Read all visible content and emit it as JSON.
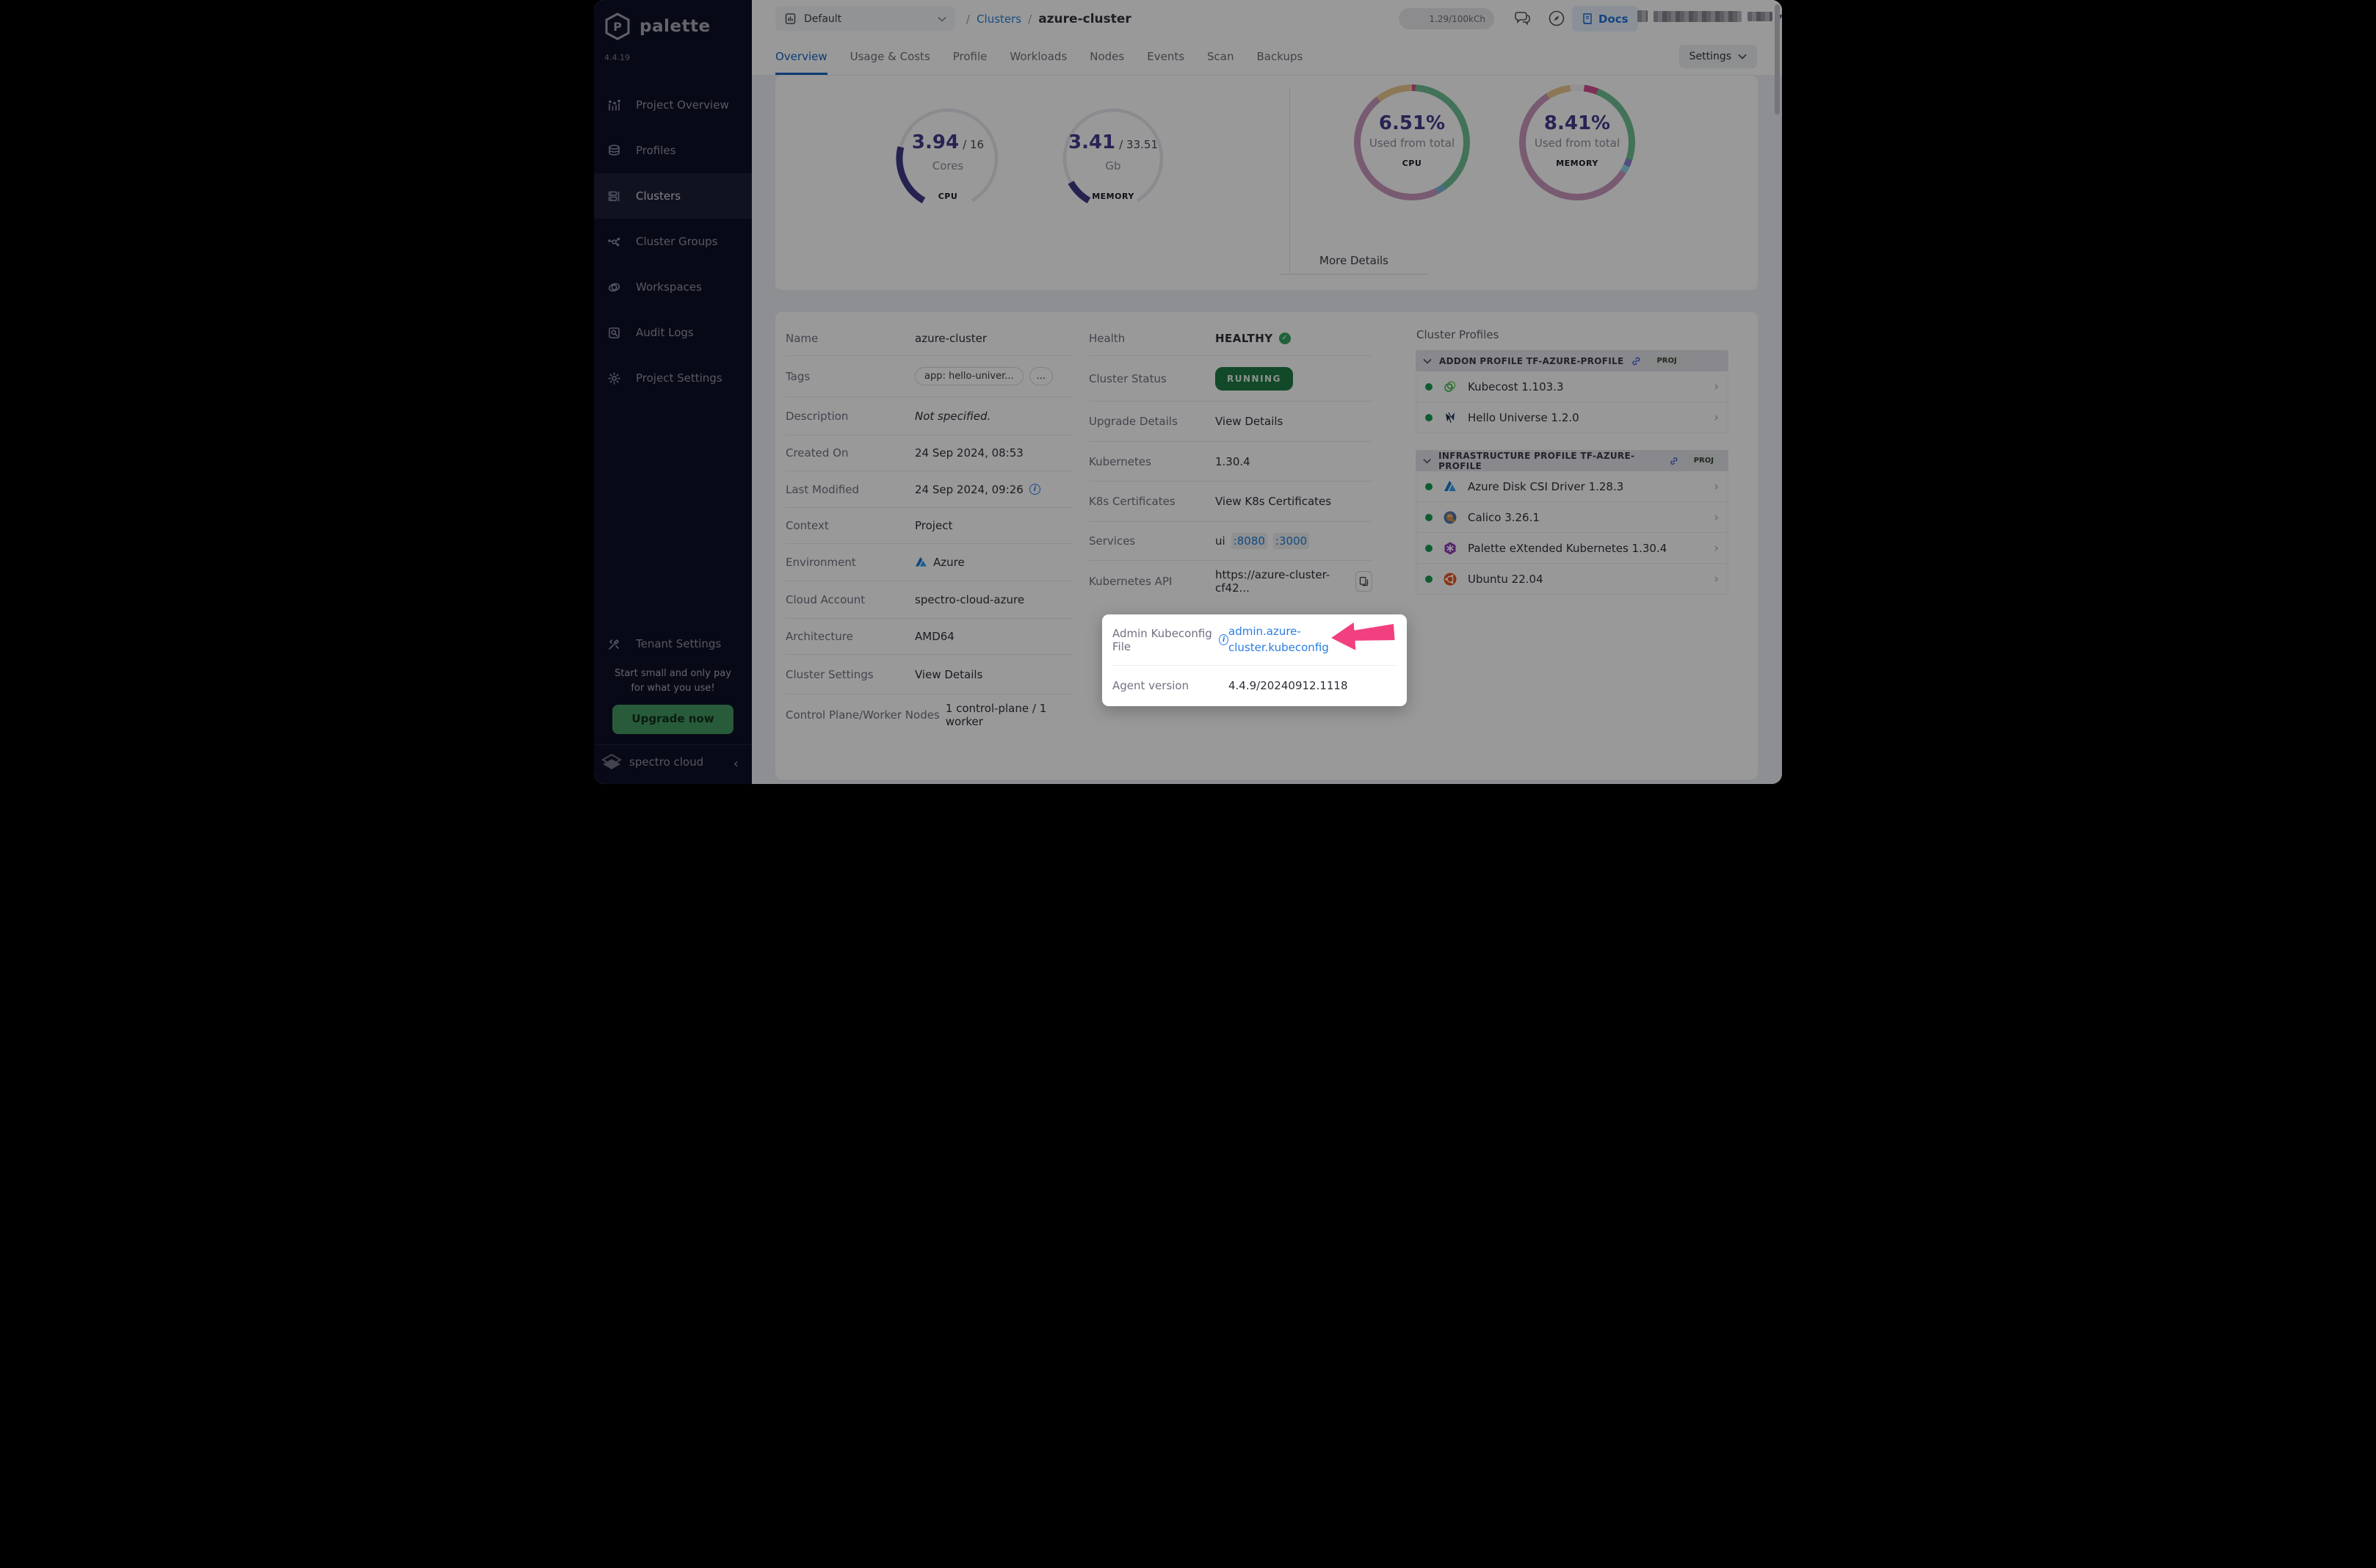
{
  "brand": {
    "name": "palette",
    "version": "4.4.19",
    "footer": "spectro cloud",
    "collapse": "‹"
  },
  "sidebar": {
    "items": [
      {
        "label": "Project Overview"
      },
      {
        "label": "Profiles"
      },
      {
        "label": "Clusters"
      },
      {
        "label": "Cluster Groups"
      },
      {
        "label": "Workspaces"
      },
      {
        "label": "Audit Logs"
      },
      {
        "label": "Project Settings"
      }
    ],
    "tenant": {
      "label": "Tenant Settings"
    },
    "promo": {
      "line1": "Start small and only pay",
      "line2": "for what you use!",
      "cta": "Upgrade now"
    }
  },
  "topbar": {
    "project": "Default",
    "breadcrumb": {
      "sep1": "/",
      "parent": "Clusters",
      "sep2": "/",
      "current": "azure-cluster"
    },
    "usage": "1.29/100kCh",
    "docs": "Docs"
  },
  "tabs": {
    "items": [
      "Overview",
      "Usage & Costs",
      "Profile",
      "Workloads",
      "Nodes",
      "Events",
      "Scan",
      "Backups"
    ],
    "active": "Overview",
    "settings": "Settings"
  },
  "summary": {
    "cpu_gauge": {
      "value": "3.94",
      "total": "/ 16",
      "unit": "Cores",
      "label": "CPU",
      "pct": 24.6,
      "color": "#3f3a85",
      "track": "#e7e7ee"
    },
    "memory_gauge": {
      "value": "3.41",
      "total": "/ 33.51",
      "unit": "Gb",
      "label": "MEMORY",
      "pct": 10.2,
      "color": "#3f3a85",
      "track": "#e7e7ee"
    },
    "cpu_donut": {
      "value": "6.51%",
      "caption": "Used from total",
      "label": "CPU",
      "segments": [
        {
          "color": "#d1518f",
          "pct": 1
        },
        {
          "color": "#6fbe92",
          "pct": 39
        },
        {
          "color": "#7ab8d9",
          "pct": 2.5
        },
        {
          "color": "#c897bd",
          "pct": 47
        },
        {
          "color": "#eac98f",
          "pct": 10.5
        }
      ]
    },
    "memory_donut": {
      "value": "8.41%",
      "caption": "Used from total",
      "label": "MEMORY",
      "segments": [
        {
          "color": "#f4f4f6",
          "pct": 2
        },
        {
          "color": "#d1518f",
          "pct": 4
        },
        {
          "color": "#6fbe92",
          "pct": 24
        },
        {
          "color": "#8a7fd1",
          "pct": 2
        },
        {
          "color": "#8ad8e8",
          "pct": 2
        },
        {
          "color": "#c897bd",
          "pct": 57
        },
        {
          "color": "#eac98f",
          "pct": 7
        },
        {
          "color": "#f4f4f6",
          "pct": 2
        }
      ]
    },
    "more_details": "More Details"
  },
  "details": {
    "name": {
      "label": "Name",
      "value": "azure-cluster"
    },
    "tags": {
      "label": "Tags",
      "pill1": "app: hello-univer...",
      "more": "..."
    },
    "description": {
      "label": "Description",
      "value": "Not specified."
    },
    "created": {
      "label": "Created On",
      "value": "24 Sep 2024, 08:53"
    },
    "modified": {
      "label": "Last Modified",
      "value": "24 Sep 2024, 09:26",
      "info": "i"
    },
    "context": {
      "label": "Context",
      "value": "Project"
    },
    "environment": {
      "label": "Environment",
      "value": "Azure"
    },
    "cloud_account": {
      "label": "Cloud Account",
      "value": "spectro-cloud-azure"
    },
    "architecture": {
      "label": "Architecture",
      "value": "AMD64"
    },
    "cluster_settings": {
      "label": "Cluster Settings",
      "link": "View Details"
    },
    "nodes": {
      "label": "Control Plane/Worker Nodes",
      "value": "1 control-plane / 1 worker"
    }
  },
  "status": {
    "health": {
      "label": "Health",
      "value": "HEALTHY",
      "check": "✓"
    },
    "cluster_status": {
      "label": "Cluster Status",
      "value": "RUNNING"
    },
    "upgrade": {
      "label": "Upgrade Details",
      "link": "View Details"
    },
    "kubernetes": {
      "label": "Kubernetes",
      "value": "1.30.4"
    },
    "certs": {
      "label": "K8s Certificates",
      "link": "View K8s Certificates"
    },
    "services": {
      "label": "Services",
      "name": "ui",
      "port1": ":8080",
      "port2": ":3000"
    },
    "api": {
      "label": "Kubernetes API",
      "value": "https://azure-cluster-cf42..."
    }
  },
  "popup": {
    "kubeconfig": {
      "label": "Admin Kubeconfig File",
      "info": "i",
      "link": "admin.azure-cluster.kubeconfig"
    },
    "agent": {
      "label": "Agent version",
      "value": "4.4.9/20240912.1118"
    }
  },
  "profiles": {
    "title": "Cluster Profiles",
    "sections": [
      {
        "header": "ADDON PROFILE TF-AZURE-PROFILE",
        "badge": "PROJ",
        "items": [
          {
            "name": "Kubecost 1.103.3"
          },
          {
            "name": "Hello Universe 1.2.0"
          }
        ]
      },
      {
        "header": "INFRASTRUCTURE PROFILE TF-AZURE-PROFILE",
        "badge": "PROJ",
        "items": [
          {
            "name": "Azure Disk CSI Driver 1.28.3"
          },
          {
            "name": "Calico 3.26.1"
          },
          {
            "name": "Palette eXtended Kubernetes 1.30.4"
          },
          {
            "name": "Ubuntu 22.04"
          }
        ]
      }
    ]
  },
  "colors": {
    "link_blue": "#217dd4",
    "healthy_green": "#35a45f",
    "running_bg": "#1e7b44",
    "arrow_pink": "#f23f7f",
    "gauge_purple": "#3f3a85",
    "upgrade_green": "#44985f",
    "active_tab_blue": "#1465c0"
  }
}
